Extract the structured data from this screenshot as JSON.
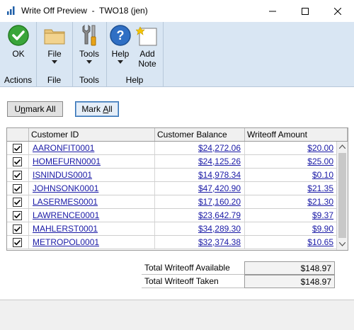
{
  "window": {
    "title": "Write Off Preview  -  TWO18 (jen)"
  },
  "ribbon": {
    "groups": [
      {
        "name": "Actions",
        "buttons": [
          {
            "label": "OK",
            "icon": "ok-check-icon"
          }
        ]
      },
      {
        "name": "File",
        "buttons": [
          {
            "label": "File",
            "icon": "folder-icon"
          }
        ]
      },
      {
        "name": "Tools",
        "buttons": [
          {
            "label": "Tools",
            "icon": "tools-icon"
          }
        ]
      },
      {
        "name": "Help",
        "buttons": [
          {
            "label": "Help",
            "icon": "help-icon"
          },
          {
            "label": "Add Note",
            "line1": "Add",
            "line2": "Note",
            "icon": "note-icon"
          }
        ]
      }
    ]
  },
  "buttons": {
    "unmark_all_pre": "U",
    "unmark_all_underline": "n",
    "unmark_all_post": "mark All",
    "mark_all_pre": "Mark ",
    "mark_all_underline": "A",
    "mark_all_post": "ll"
  },
  "grid": {
    "columns": [
      "",
      "Customer ID",
      "Customer Balance",
      "Writeoff Amount"
    ],
    "rows": [
      {
        "checked": true,
        "customer_id": "AARONFIT0001",
        "balance": "$24,272.06",
        "writeoff": "$20.00"
      },
      {
        "checked": true,
        "customer_id": "HOMEFURN0001",
        "balance": "$24,125.26",
        "writeoff": "$25.00"
      },
      {
        "checked": true,
        "customer_id": "ISNINDUS0001",
        "balance": "$14,978.34",
        "writeoff": "$0.10"
      },
      {
        "checked": true,
        "customer_id": "JOHNSONK0001",
        "balance": "$47,420.90",
        "writeoff": "$21.35"
      },
      {
        "checked": true,
        "customer_id": "LASERMES0001",
        "balance": "$17,160.20",
        "writeoff": "$21.30"
      },
      {
        "checked": true,
        "customer_id": "LAWRENCE0001",
        "balance": "$23,642.79",
        "writeoff": "$9.37"
      },
      {
        "checked": true,
        "customer_id": "MAHLERST0001",
        "balance": "$34,289.30",
        "writeoff": "$9.90"
      },
      {
        "checked": true,
        "customer_id": "METROPOL0001",
        "balance": "$32,374.38",
        "writeoff": "$10.65"
      }
    ]
  },
  "totals": {
    "available_label": "Total Writeoff Available",
    "available_value": "$148.97",
    "taken_label": "Total Writeoff Taken",
    "taken_value": "$148.97"
  },
  "colors": {
    "ribbon_bg": "#d9e6f3",
    "link": "#1a1aa6"
  }
}
